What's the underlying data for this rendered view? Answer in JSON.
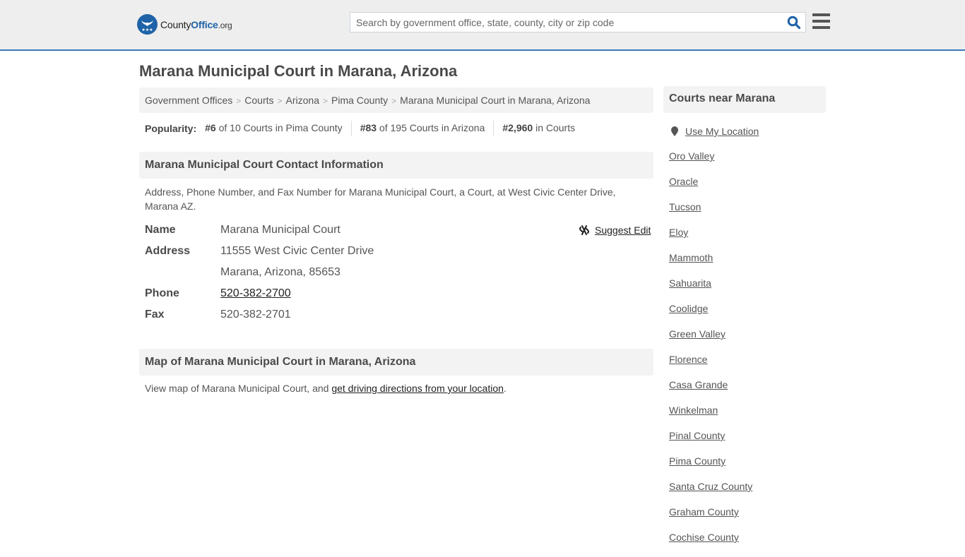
{
  "header": {
    "logo": {
      "county": "County",
      "office": "Office",
      "tld": ".org"
    },
    "search": {
      "placeholder": "Search by government office, state, county, city or zip code",
      "value": ""
    },
    "brand_color": "#1e63a8",
    "accent_border": "#3a7ab8"
  },
  "page": {
    "title": "Marana Municipal Court in Marana, Arizona"
  },
  "breadcrumb": [
    "Government Offices",
    "Courts",
    "Arizona",
    "Pima County",
    "Marana Municipal Court in Marana, Arizona"
  ],
  "popularity": {
    "label": "Popularity:",
    "items": [
      {
        "rank": "#6",
        "text": "of 10 Courts in Pima County"
      },
      {
        "rank": "#83",
        "text": "of 195 Courts in Arizona"
      },
      {
        "rank": "#2,960",
        "text": "in Courts"
      }
    ]
  },
  "contact": {
    "heading": "Marana Municipal Court Contact Information",
    "description": "Address, Phone Number, and Fax Number for Marana Municipal Court, a Court, at West Civic Center Drive, Marana AZ.",
    "suggest_edit": "Suggest Edit",
    "fields": {
      "name_label": "Name",
      "name": "Marana Municipal Court",
      "address_label": "Address",
      "address_line1": "11555 West Civic Center Drive",
      "address_line2": "Marana, Arizona, 85653",
      "phone_label": "Phone",
      "phone": "520-382-2700",
      "fax_label": "Fax",
      "fax": "520-382-2701"
    }
  },
  "map": {
    "heading": "Map of Marana Municipal Court in Marana, Arizona",
    "text_before": "View map of Marana Municipal Court, and ",
    "link": "get driving directions from your location",
    "text_after": "."
  },
  "sidebar": {
    "heading": "Courts near Marana",
    "use_location": "Use My Location",
    "items": [
      "Oro Valley",
      "Oracle",
      "Tucson",
      "Eloy",
      "Mammoth",
      "Sahuarita",
      "Coolidge",
      "Green Valley",
      "Florence",
      "Casa Grande",
      "Winkelman",
      "Pinal County",
      "Pima County",
      "Santa Cruz County",
      "Graham County",
      "Cochise County"
    ]
  }
}
